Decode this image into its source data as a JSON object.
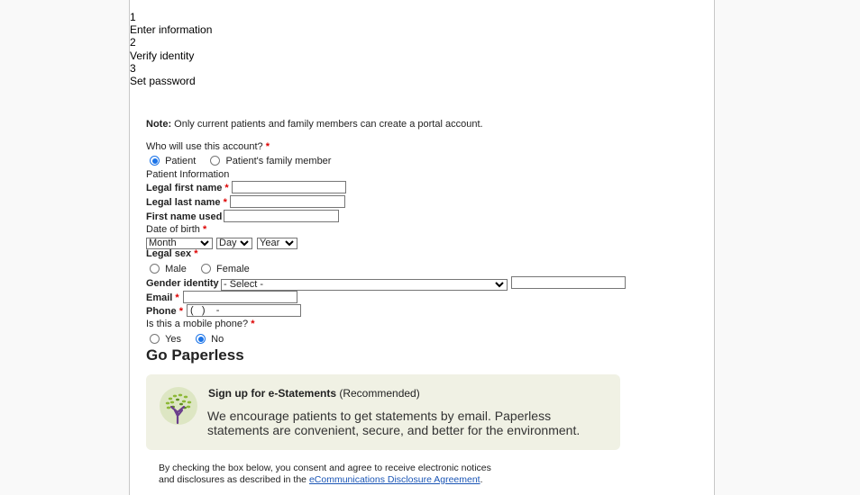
{
  "steps": [
    {
      "number": "1",
      "label": "Enter information"
    },
    {
      "number": "2",
      "label": "Verify identity"
    },
    {
      "number": "3",
      "label": "Set password"
    }
  ],
  "note": {
    "prefix": "Note:",
    "text": " Only current patients and family members can create a portal account."
  },
  "who": {
    "label": "Who will use this account?",
    "required": "*",
    "options": [
      {
        "label": "Patient",
        "selected": true
      },
      {
        "label": "Patient's family member",
        "selected": false
      }
    ]
  },
  "section_title": "Patient Information",
  "fields": {
    "first_name": {
      "label": "Legal first name",
      "required": "*",
      "value": ""
    },
    "last_name": {
      "label": "Legal last name",
      "required": "*",
      "value": ""
    },
    "name_used": {
      "label": "First name used",
      "value": ""
    },
    "dob": {
      "label": "Date of birth",
      "required": "*",
      "month": "Month",
      "day": "Day",
      "year": "Year"
    },
    "sex": {
      "label": "Legal sex",
      "required": "*",
      "options": [
        {
          "label": "Male",
          "selected": false
        },
        {
          "label": "Female",
          "selected": false
        }
      ]
    },
    "gender": {
      "label": "Gender identity",
      "selected": "- Select -",
      "other_value": ""
    },
    "email": {
      "label": "Email",
      "required": "*",
      "value": ""
    },
    "phone": {
      "label": "Phone",
      "required": "*",
      "value": "(   )    -"
    },
    "mobile": {
      "label": "Is this a mobile phone?",
      "required": "*",
      "options": [
        {
          "label": "Yes",
          "selected": false
        },
        {
          "label": "No",
          "selected": true
        }
      ]
    }
  },
  "paperless": {
    "heading": "Go Paperless",
    "box_title_bold": "Sign up for e-Statements",
    "box_title_rest": " (Recommended)",
    "box_body": "We encourage patients to get statements by email. Paperless statements are convenient, secure, and better for the environment.",
    "icon": "tree-icon"
  },
  "consent": {
    "line1": "By checking the box below, you consent and agree to receive electronic notices",
    "line2_prefix": "and disclosures as described in the ",
    "link": "eCommunications Disclosure Agreement",
    "line2_suffix": "."
  }
}
